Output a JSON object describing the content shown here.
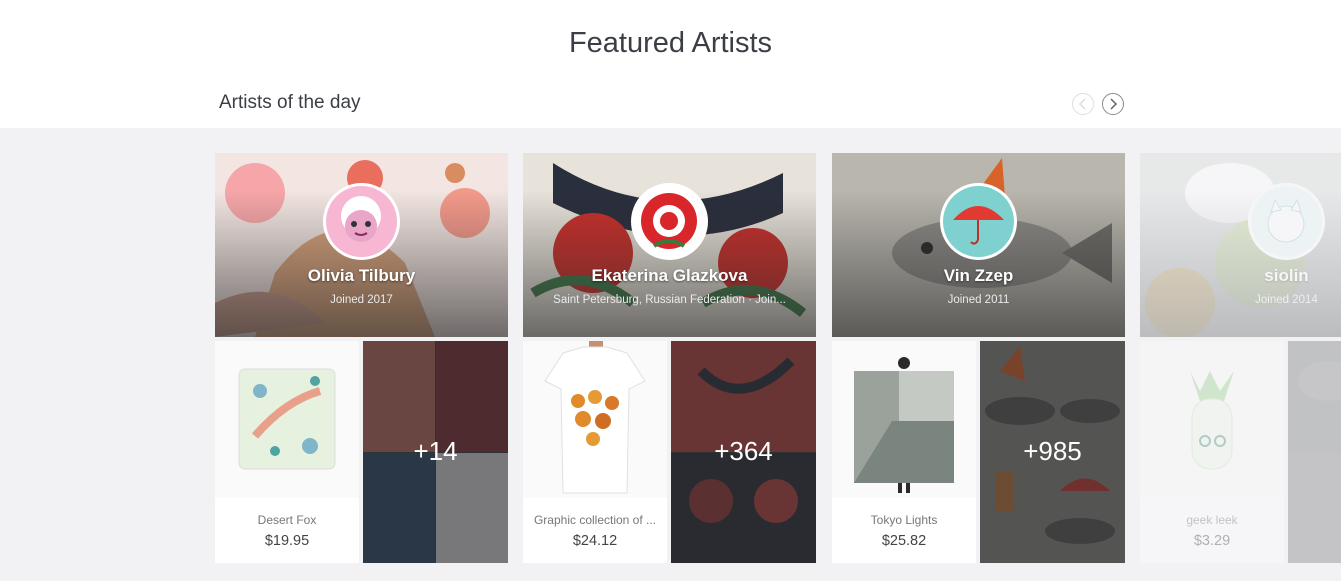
{
  "page": {
    "title": "Featured Artists",
    "section_title": "Artists of the day",
    "nav": {
      "prev_icon": "chevron-left-icon",
      "next_icon": "chevron-right-icon"
    }
  },
  "artists": [
    {
      "name": "Olivia Tilbury",
      "meta": "Joined 2017",
      "product": {
        "name": "Desert Fox",
        "price": "$19.95"
      },
      "more_count": "+14"
    },
    {
      "name": "Ekaterina Glazkova",
      "meta": "Saint Petersburg, Russian Federation  ·  Join...",
      "product": {
        "name": "Graphic collection of ...",
        "price": "$24.12"
      },
      "more_count": "+364"
    },
    {
      "name": "Vin Zzep",
      "meta": "Joined 2011",
      "product": {
        "name": "Tokyo Lights",
        "price": "$25.82"
      },
      "more_count": "+985"
    },
    {
      "name": "siolin",
      "meta": "Joined 2014",
      "product": {
        "name": "geek leek",
        "price": "$3.29"
      },
      "more_count": ""
    }
  ],
  "colors": {
    "background_band": "#f2f2f5",
    "title_text": "#3b3f45"
  }
}
